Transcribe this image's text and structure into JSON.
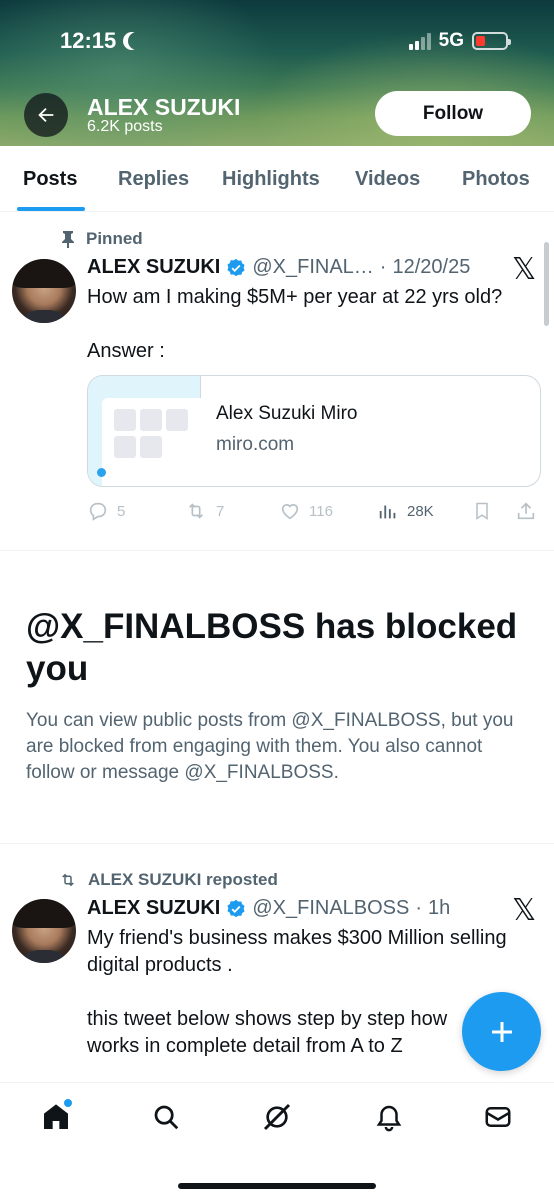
{
  "status_bar": {
    "time": "12:15",
    "network": "5G",
    "battery_color": "#ff3b30"
  },
  "profile": {
    "name": "ALEX SUZUKI",
    "posts_count": "6.2K posts",
    "follow_label": "Follow"
  },
  "tabs": [
    {
      "label": "Posts",
      "active": true
    },
    {
      "label": "Replies",
      "active": false
    },
    {
      "label": "Highlights",
      "active": false
    },
    {
      "label": "Videos",
      "active": false
    },
    {
      "label": "Photos",
      "active": false
    }
  ],
  "pinned_tweet": {
    "pinned_label": "Pinned",
    "author": "ALEX SUZUKI",
    "handle": "@X_FINAL…",
    "dot": "·",
    "date": "12/20/25",
    "text_line1": "How am I making $5M+ per year at 22 yrs old?",
    "text_line2": "Answer :",
    "card": {
      "title": "Alex Suzuki Miro",
      "domain": "miro.com"
    },
    "stats": {
      "replies": "5",
      "reposts": "7",
      "likes": "116",
      "views": "28K"
    }
  },
  "blocked": {
    "title": "@X_FINALBOSS has blocked you",
    "body": "You can view public posts from @X_FINALBOSS, but you are blocked from engaging with them. You also cannot follow or message @X_FINALBOSS."
  },
  "repost_tweet": {
    "repost_label": "ALEX SUZUKI reposted",
    "author": "ALEX SUZUKI",
    "handle": "@X_FINALBOSS",
    "dot": "·",
    "time": "1h",
    "text_line1": "My friend's business makes $300 Million selling",
    "text_line2": "digital products .",
    "text_line3": "this tweet below shows step by step how",
    "text_line4": "works in complete detail from A to Z"
  },
  "x_logo": "𝕏",
  "colors": {
    "accent": "#1d9bf0",
    "text": "#0f1419",
    "secondary": "#536471"
  },
  "bottom_nav": [
    "home-icon",
    "search-icon",
    "grok-icon",
    "notifications-icon",
    "messages-icon"
  ]
}
